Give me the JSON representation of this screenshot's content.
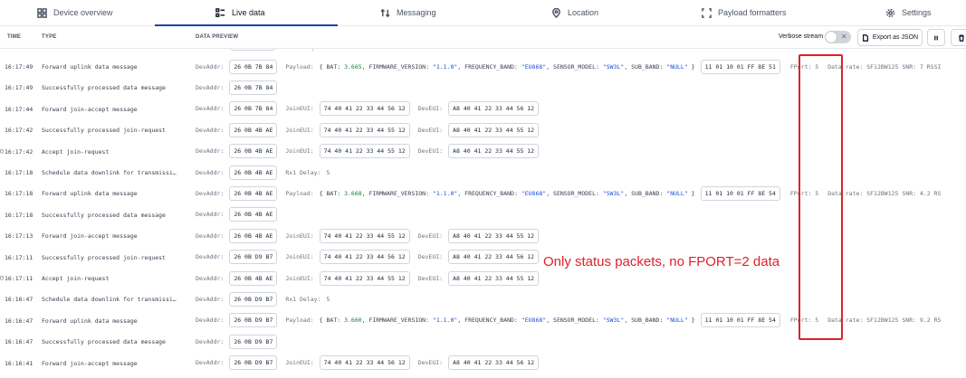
{
  "tabs": [
    {
      "label": "Device overview",
      "icon": "grid-icon"
    },
    {
      "label": "Live data",
      "icon": "list-icon",
      "active": true
    },
    {
      "label": "Messaging",
      "icon": "arrows-updown-icon"
    },
    {
      "label": "Location",
      "icon": "location-pin-icon"
    },
    {
      "label": "Payload formatters",
      "icon": "code-brackets-icon"
    },
    {
      "label": "Settings",
      "icon": "gear-icon"
    }
  ],
  "header": {
    "columns": [
      "TIME",
      "TYPE",
      "DATA PREVIEW"
    ],
    "verbose_label": "Verbose stream",
    "export_label": "Export as JSON"
  },
  "labels": {
    "devaddr": "DevAddr:",
    "payload": "Payload:",
    "joineui": "JoinEUI:",
    "deveui": "DevEUI:",
    "rx1": "Rx1 Delay:"
  },
  "rows": [
    {
      "time": "16:17:49",
      "type": "Forward uplink data message",
      "devaddr": "26 0B 7B 84",
      "payload": {
        "bat": "3.665",
        "fw": "\"1.1.0\"",
        "band": "\"EU868\"",
        "model": "\"SW3L\"",
        "sub": "\"NULL\""
      },
      "hex": "11 01 10 01 FF 8E 51",
      "fport": "FPort: 5",
      "meta": "Data rate: SF12BW125  SNR: 7  RSSI"
    },
    {
      "time": "16:17:49",
      "type": "Successfully processed data message",
      "devaddr": "26 0B 7B 84"
    },
    {
      "time": "16:17:44",
      "type": "Forward join-accept message",
      "devaddr": "26 0B 7B 84",
      "joineui": "74 40 41 22 33 44 56 12",
      "deveui": "A8 40 41 22 33 44 56 12"
    },
    {
      "time": "16:17:42",
      "type": "Successfully processed join-request",
      "devaddr": "26 0B 4B AE",
      "joineui": "74 40 41 22 33 44 55 12",
      "deveui": "A8 40 41 22 33 44 55 12"
    },
    {
      "time": "16:17:42",
      "type": "Accept join-request",
      "devaddr": "26 0B 4B AE",
      "joineui": "74 40 41 22 33 44 55 12",
      "deveui": "A8 40 41 22 33 44 55 12",
      "dot": true
    },
    {
      "time": "16:17:18",
      "type": "Schedule data downlink for transmissi…",
      "devaddr": "26 0B 4B AE",
      "rx1": "5"
    },
    {
      "time": "16:17:18",
      "type": "Forward uplink data message",
      "devaddr": "26 0B 4B AE",
      "payload": {
        "bat": "3.668",
        "fw": "\"1.1.0\"",
        "band": "\"EU868\"",
        "model": "\"SW3L\"",
        "sub": "\"NULL\""
      },
      "hex": "11 01 10 01 FF 8E 54",
      "fport": "FPort: 5",
      "meta": "Data rate: SF12BW125  SNR: 4.2  RS"
    },
    {
      "time": "16:17:18",
      "type": "Successfully processed data message",
      "devaddr": "26 0B 4B AE"
    },
    {
      "time": "16:17:13",
      "type": "Forward join-accept message",
      "devaddr": "26 0B 4B AE",
      "joineui": "74 40 41 22 33 44 55 12",
      "deveui": "A8 40 41 22 33 44 55 12"
    },
    {
      "time": "16:17:11",
      "type": "Successfully processed join-request",
      "devaddr": "26 0B D9 B7",
      "joineui": "74 40 41 22 33 44 56 12",
      "deveui": "A8 40 41 22 33 44 56 12"
    },
    {
      "time": "16:17:11",
      "type": "Accept join-request",
      "devaddr": "26 0B 4B AE",
      "joineui": "74 40 41 22 33 44 55 12",
      "deveui": "A8 40 41 22 33 44 55 12",
      "dot": true
    },
    {
      "time": "16:16:47",
      "type": "Schedule data downlink for transmissi…",
      "devaddr": "26 0B D9 B7",
      "rx1": "5"
    },
    {
      "time": "16:16:47",
      "type": "Forward uplink data message",
      "devaddr": "26 0B D9 B7",
      "payload": {
        "bat": "3.660",
        "fw": "\"1.1.0\"",
        "band": "\"EU868\"",
        "model": "\"SW3L\"",
        "sub": "\"NULL\""
      },
      "hex": "11 01 10 01 FF 8E 54",
      "fport": "FPort: 5",
      "meta": "Data rate: SF12BW125  SNR: 9.2  RS"
    },
    {
      "time": "16:16:47",
      "type": "Successfully processed data message",
      "devaddr": "26 0B D9 B7"
    },
    {
      "time": "16:16:41",
      "type": "Forward join-accept message",
      "devaddr": "26 0B D9 B7",
      "joineui": "74 40 41 22 33 44 56 12",
      "deveui": "A8 40 41 22 33 44 56 12"
    }
  ],
  "annotation": {
    "text": "Only status packets, no FPORT=2 data",
    "color": "#e0202a"
  },
  "colors": {
    "accent": "#1e40af",
    "string": "#1d4ed8",
    "number": "#15803d"
  }
}
